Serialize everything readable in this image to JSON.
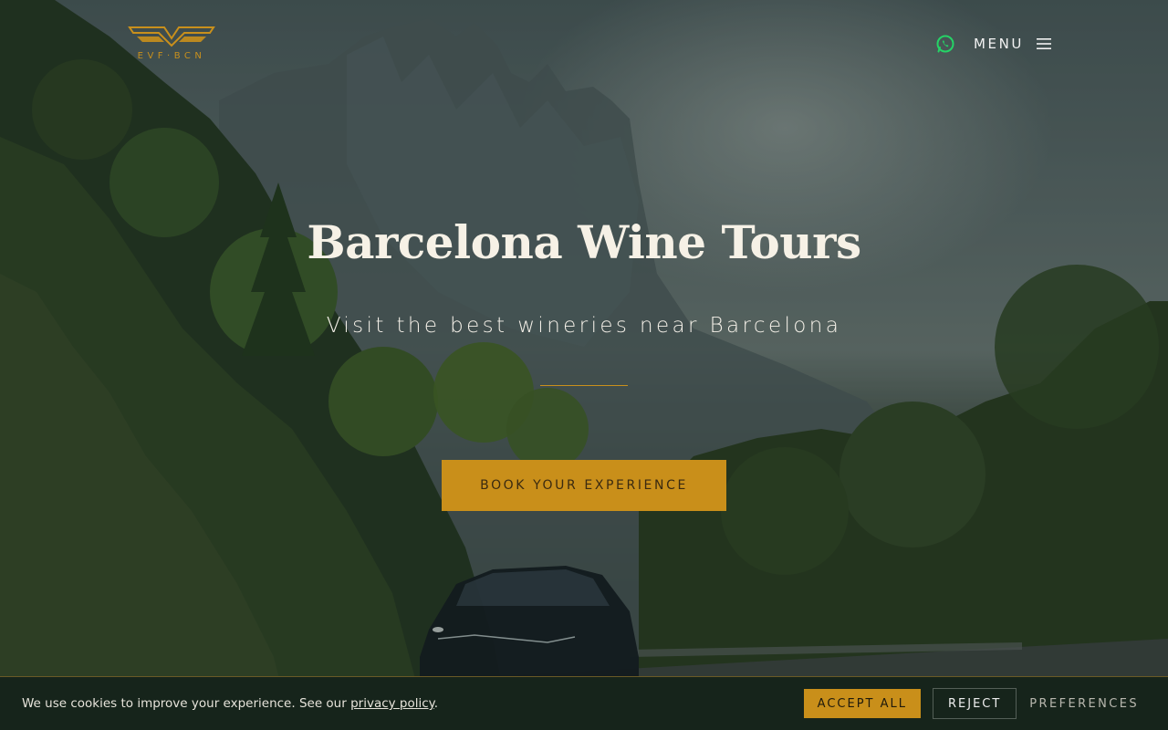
{
  "header": {
    "logo_text": "EVF·BCN",
    "menu_label": "MENU",
    "whatsapp_icon": "whatsapp-icon",
    "menu_icon": "hamburger-icon"
  },
  "hero": {
    "title": "Barcelona Wine Tours",
    "subtitle": "Visit the best wineries near Barcelona",
    "cta_label": "BOOK YOUR EXPERIENCE"
  },
  "cookie_bar": {
    "text_before_link": "We use cookies to improve your experience. See our ",
    "link_text": "privacy policy",
    "text_after_link": ".",
    "accept_label": "ACCEPT ALL",
    "reject_label": "REJECT",
    "preferences_label": "PREFERENCES"
  },
  "colors": {
    "accent": "#c98f1a",
    "whatsapp": "#25d366",
    "cookie_bg": "#16241b"
  }
}
